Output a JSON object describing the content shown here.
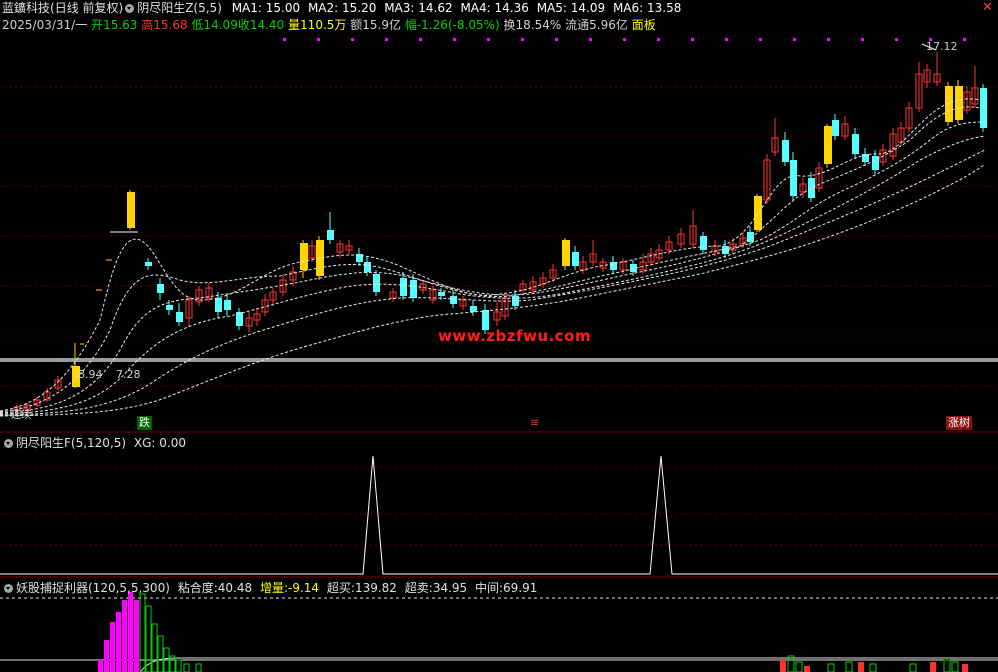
{
  "header": {
    "stock_name": "蓝鑛科技",
    "period": "(日线 前复权)",
    "indicator": "阴尽阳生Z(5,5)",
    "ma1": "MA1: 15.00",
    "ma2": "MA2: 15.20",
    "ma3": "MA3: 14.62",
    "ma4": "MA4: 14.36",
    "ma5": "MA5: 14.09",
    "ma6": "MA6: 13.58"
  },
  "quote": {
    "date": "2025/03/31/一",
    "open_label": "开",
    "open": "15.63",
    "high_label": "高",
    "high": "15.68",
    "low_label": "低",
    "low": "14.09",
    "close_label": "收",
    "close": "14.40",
    "vol_label": "量",
    "vol": "110.5万",
    "amount_label": "额",
    "amount": "15.9亿",
    "change_label": "幅",
    "change": "-1.26(-8.05%)",
    "turnover_label": "换",
    "turnover": "18.54%",
    "float_label": "流通",
    "float": "5.96亿",
    "board": "面板"
  },
  "main_chart": {
    "max_label": "17.12",
    "low_label1": "8.94",
    "low_label2": "7.28",
    "left_label": "--连续--",
    "tag_down": "跌",
    "tag_mid": "≋",
    "tag_right": "涨树"
  },
  "panel2": {
    "title": "阴尽阳生F(5,120,5)",
    "xg": "XG: 0.00"
  },
  "panel3": {
    "title": "妖股捕捉利器(120,5,5,300)",
    "stick_label": "粘合度:",
    "stick": "40.48",
    "inc_label": "增量:",
    "inc": "-9.14",
    "overbuy_label": "超买:",
    "overbuy": "139.82",
    "oversell_label": "超卖:",
    "oversell": "34.95",
    "mid_label": "中间:",
    "mid": "69.91"
  },
  "watermark": "www.zbzfwu.com",
  "colors": {
    "up": "#ff3232",
    "down": "#54ffff",
    "limit": "#ffd400",
    "dot": "#ff00ff",
    "green": "#00d200",
    "yellow": "#ffff00",
    "magenta": "#ff00ff"
  }
}
